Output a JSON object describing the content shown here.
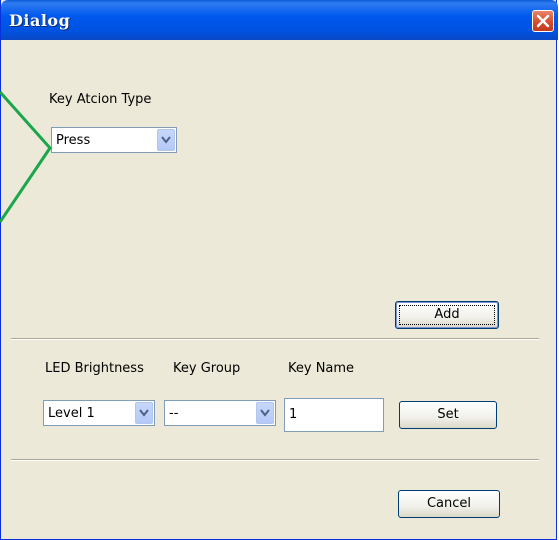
{
  "window": {
    "title": "Dialog"
  },
  "key_action": {
    "label": "Key Atcion Type",
    "selected": "Press"
  },
  "buttons": {
    "add": "Add",
    "set": "Set",
    "cancel": "Cancel"
  },
  "settings": {
    "led_label": "LED Brightness",
    "led_selected": "Level 1",
    "group_label": "Key Group",
    "group_selected": "--",
    "name_label": "Key Name",
    "name_value": "1"
  },
  "colors": {
    "annotation_line": "#1aa64a",
    "titlebar": "#0058ee",
    "window_bg": "#ece9d8"
  }
}
